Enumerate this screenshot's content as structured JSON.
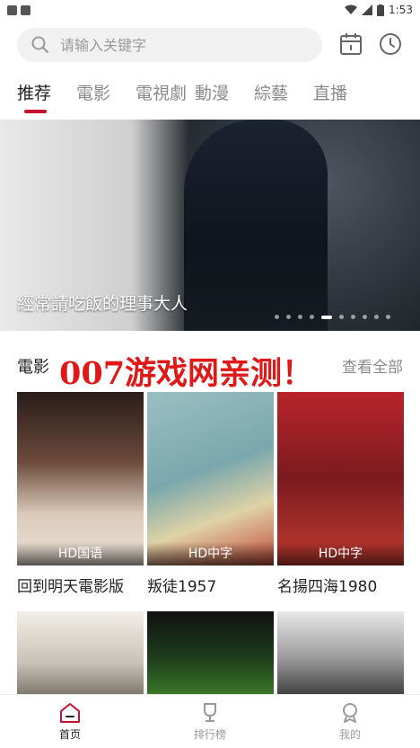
{
  "status_bar": {
    "time": "1:53"
  },
  "search": {
    "placeholder": "请输入关键字"
  },
  "tabs": [
    {
      "label": "推荐"
    },
    {
      "label": "電影"
    },
    {
      "label": "電視劇"
    },
    {
      "label": "動漫"
    },
    {
      "label": "綜藝"
    },
    {
      "label": "直播"
    }
  ],
  "banner": {
    "caption": "經常請吃飯的理事大人",
    "dot_count": 10,
    "active_dot": 5
  },
  "section": {
    "title": "電影",
    "more_label": "查看全部",
    "watermark": "007游戏网亲测！"
  },
  "movies": [
    {
      "title": "回到明天電影版",
      "badge": "HD国语"
    },
    {
      "title": "叛徒1957",
      "badge": "HD中字"
    },
    {
      "title": "名揚四海1980",
      "badge": "HD中字"
    }
  ],
  "bottom_nav": [
    {
      "label": "首页"
    },
    {
      "label": "排行榜"
    },
    {
      "label": "我的"
    }
  ],
  "colors": {
    "accent": "#c8102e",
    "watermark": "#e01818"
  }
}
